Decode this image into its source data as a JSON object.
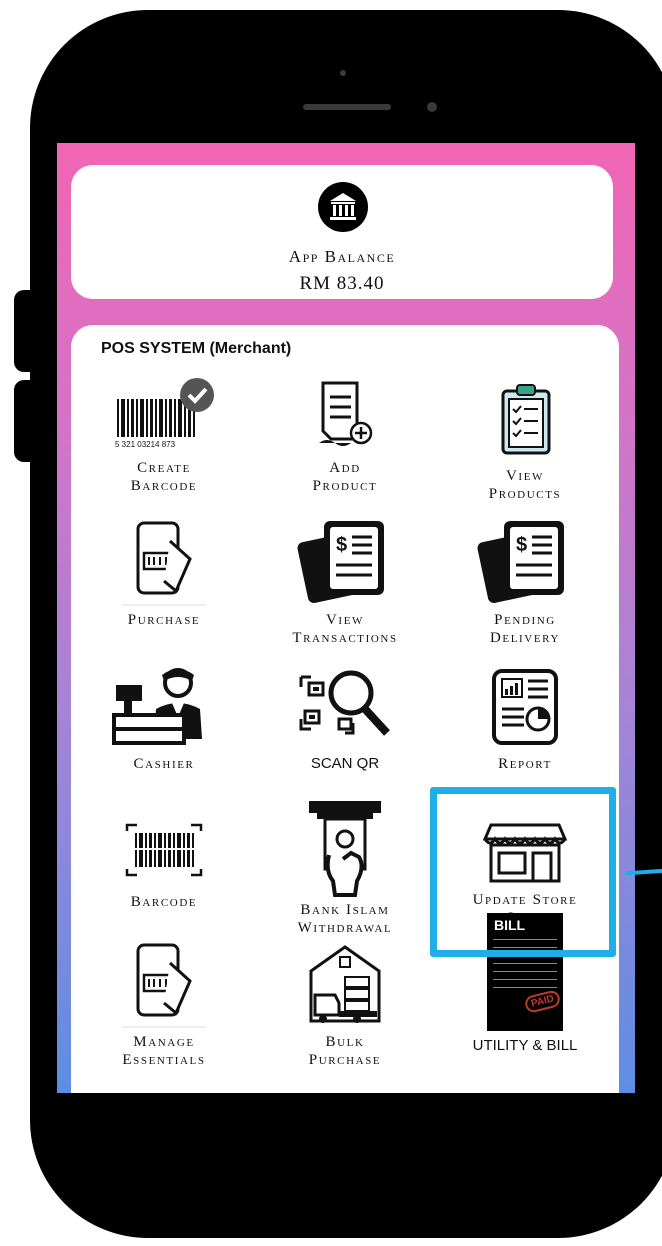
{
  "balance": {
    "title": "App Balance",
    "value": "RM 83.40"
  },
  "pos": {
    "title": "POS SYSTEM (Merchant)",
    "items": [
      {
        "line1": "Create",
        "line2": "Barcode",
        "icon": "barcode-check-icon"
      },
      {
        "line1": "Add",
        "line2": "Product",
        "icon": "document-add-icon"
      },
      {
        "line1": "View",
        "line2": "Products",
        "icon": "clipboard-checklist-icon"
      },
      {
        "line1": "Purchase",
        "line2": "",
        "icon": "phone-scan-payment-icon"
      },
      {
        "line1": "View",
        "line2": "Transactions",
        "icon": "invoice-stack-icon"
      },
      {
        "line1": "Pending",
        "line2": "Delivery",
        "icon": "invoice-stack-icon"
      },
      {
        "line1": "Cashier",
        "line2": "",
        "icon": "cashier-icon"
      },
      {
        "line1": "SCAN QR",
        "line2": "",
        "icon": "qr-magnifier-icon"
      },
      {
        "line1": "Report",
        "line2": "",
        "icon": "report-chart-icon"
      },
      {
        "line1": "Barcode",
        "line2": "",
        "icon": "barcode-scan-icon"
      },
      {
        "line1": "Bank Islam",
        "line2": "Withdrawal",
        "icon": "atm-withdrawal-icon"
      },
      {
        "line1": "Update Store",
        "line2": "Info",
        "icon": "storefront-icon"
      },
      {
        "line1": "Manage",
        "line2": "Essentials",
        "icon": "phone-scan-payment-icon"
      },
      {
        "line1": "Bulk",
        "line2": "Purchase",
        "icon": "warehouse-truck-icon"
      },
      {
        "line1": "UTILITY & BILL",
        "line2": "",
        "icon": "bill-paid-icon",
        "badge": "BILL",
        "stamp": "PAID"
      }
    ]
  },
  "colors": {
    "highlight": "#1eaee8",
    "gradient_top": "#f165b4",
    "gradient_bottom": "#5d8ee3"
  }
}
